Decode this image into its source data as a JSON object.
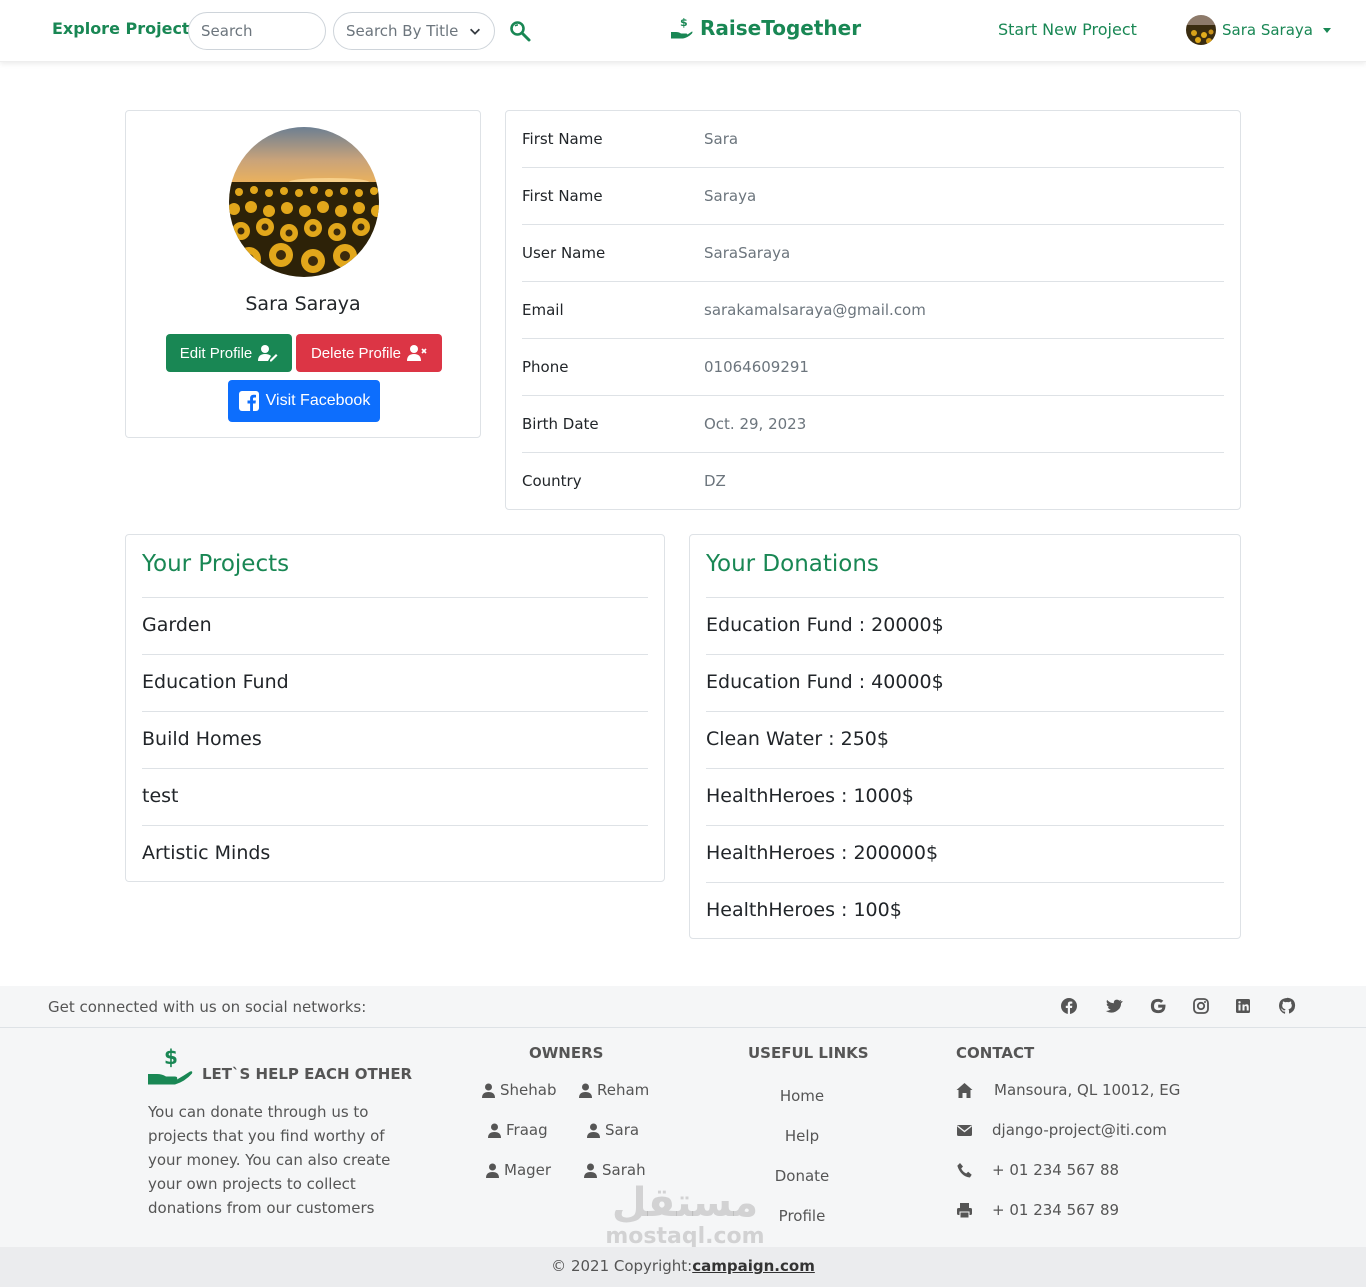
{
  "nav": {
    "explore": "Explore Projects",
    "search_placeholder": "Search",
    "search_by": "Search By Title",
    "brand": "RaiseTogether",
    "start_project": "Start New Project",
    "user_name": "Sara Saraya"
  },
  "profile": {
    "name": "Sara Saraya",
    "edit_label": "Edit Profile",
    "delete_label": "Delete Profile",
    "facebook_label": "Visit Facebook"
  },
  "info": [
    {
      "label": "First Name",
      "value": "Sara"
    },
    {
      "label": "First Name",
      "value": "Saraya"
    },
    {
      "label": "User Name",
      "value": "SaraSaraya"
    },
    {
      "label": "Email",
      "value": "sarakamalsaraya@gmail.com"
    },
    {
      "label": "Phone",
      "value": "01064609291"
    },
    {
      "label": "Birth Date",
      "value": "Oct. 29, 2023"
    },
    {
      "label": "Country",
      "value": "DZ"
    }
  ],
  "projects": {
    "title": "Your Projects",
    "items": [
      "Garden",
      "Education Fund",
      "Build Homes",
      "test",
      "Artistic Minds"
    ]
  },
  "donations": {
    "title": "Your Donations",
    "items": [
      "Education Fund : 20000$",
      "Education Fund : 40000$",
      "Clean Water : 250$",
      "HealthHeroes : 1000$",
      "HealthHeroes : 200000$",
      "HealthHeroes : 100$"
    ]
  },
  "footer": {
    "social_text": "Get connected with us on social networks:",
    "social_icons": [
      "facebook-icon",
      "twitter-icon",
      "google-icon",
      "instagram-icon",
      "linkedin-icon",
      "github-icon"
    ],
    "tagline": "LET`S HELP EACH OTHER",
    "description": "You can donate through us to projects that you find worthy of your money. You can also create your own projects to collect donations from our customers",
    "owners_title": "OWNERS",
    "owners": [
      "Shehab",
      "Reham",
      "Fraag",
      "Sara",
      "Mager",
      "Sarah"
    ],
    "links_title": "USEFUL LINKS",
    "links": [
      "Home",
      "Help",
      "Donate",
      "Profile"
    ],
    "contact_title": "CONTACT",
    "contact": {
      "address": "Mansoura, QL 10012, EG",
      "email": "django-project@iti.com",
      "phone": "+ 01 234 567 88",
      "fax": "+ 01 234 567 89"
    },
    "copyright_prefix": "© 2021 Copyright:",
    "copyright_link": "campaign.com"
  },
  "watermark": {
    "arabic": "مستقل",
    "latin": "mostaql.com"
  },
  "colors": {
    "primary": "#198754",
    "danger": "#dc3545",
    "facebook": "#0d6efd",
    "footer_bg": "#f5f6f7"
  }
}
